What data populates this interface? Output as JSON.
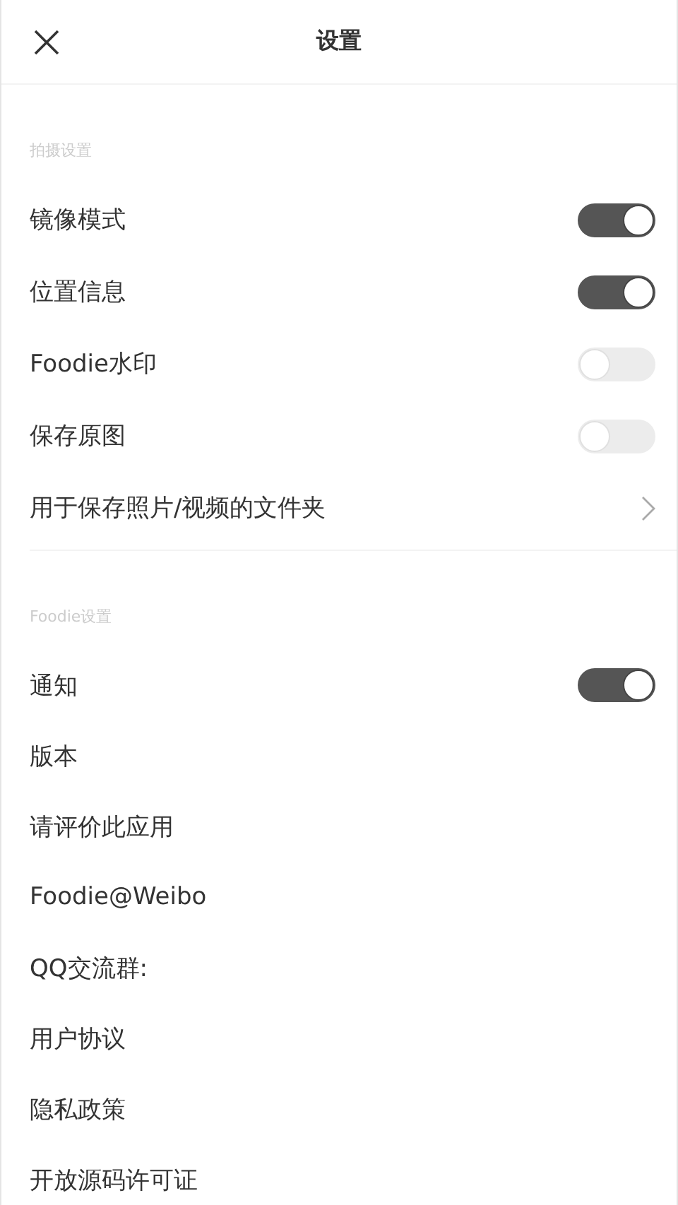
{
  "header": {
    "title": "设置"
  },
  "sections": [
    {
      "title": "拍摄设置",
      "items": [
        {
          "label": "镜像模式",
          "kind": "toggle",
          "on": true
        },
        {
          "label": "位置信息",
          "kind": "toggle",
          "on": true
        },
        {
          "label": "Foodie水印",
          "kind": "toggle",
          "on": false
        },
        {
          "label": "保存原图",
          "kind": "toggle",
          "on": false
        },
        {
          "label": "用于保存照片/视频的文件夹",
          "kind": "link"
        }
      ]
    },
    {
      "title": "Foodie设置",
      "items": [
        {
          "label": "通知",
          "kind": "toggle",
          "on": true
        },
        {
          "label": "版本",
          "kind": "plain"
        },
        {
          "label": "请评价此应用",
          "kind": "plain"
        },
        {
          "label": "Foodie@Weibo",
          "kind": "plain"
        },
        {
          "label": "QQ交流群:",
          "kind": "plain"
        },
        {
          "label": "用户协议",
          "kind": "plain"
        },
        {
          "label": "隐私政策",
          "kind": "plain"
        },
        {
          "label": "开放源码许可证",
          "kind": "plain"
        }
      ]
    }
  ]
}
